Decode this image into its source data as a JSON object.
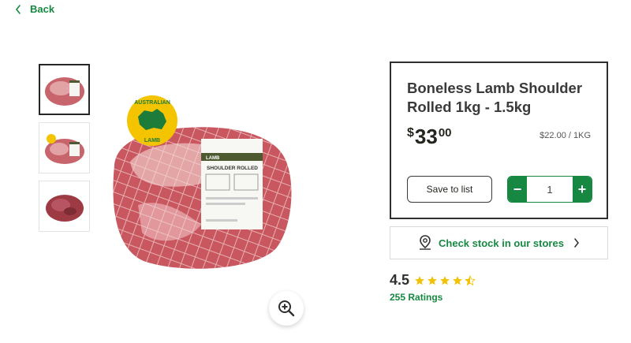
{
  "nav": {
    "back_label": "Back"
  },
  "gallery": {
    "thumbnails": [
      {
        "alt": "packaged lamb shoulder front",
        "selected": true
      },
      {
        "alt": "lamb shoulder with badge",
        "selected": false
      },
      {
        "alt": "unwrapped lamb shoulder",
        "selected": false
      }
    ],
    "badge_top": "AUSTRALIAN",
    "badge_bottom": "LAMB",
    "label_brand": "LAMB",
    "label_title": "SHOULDER ROLLED"
  },
  "product": {
    "title": "Boneless Lamb Shoulder Rolled 1kg - 1.5kg",
    "price_currency": "$",
    "price_dollars": "33",
    "price_cents": "00",
    "unit_price": "$22.00 / 1KG",
    "save_label": "Save to list",
    "quantity": "1",
    "minus_label": "−",
    "plus_label": "+"
  },
  "stock": {
    "label": "Check stock in our stores"
  },
  "rating": {
    "value": "4.5",
    "stars": 4.5,
    "count_label": "255 Ratings"
  },
  "colors": {
    "accent": "#178841",
    "star": "#f2c200",
    "badge": "#f4c400"
  }
}
